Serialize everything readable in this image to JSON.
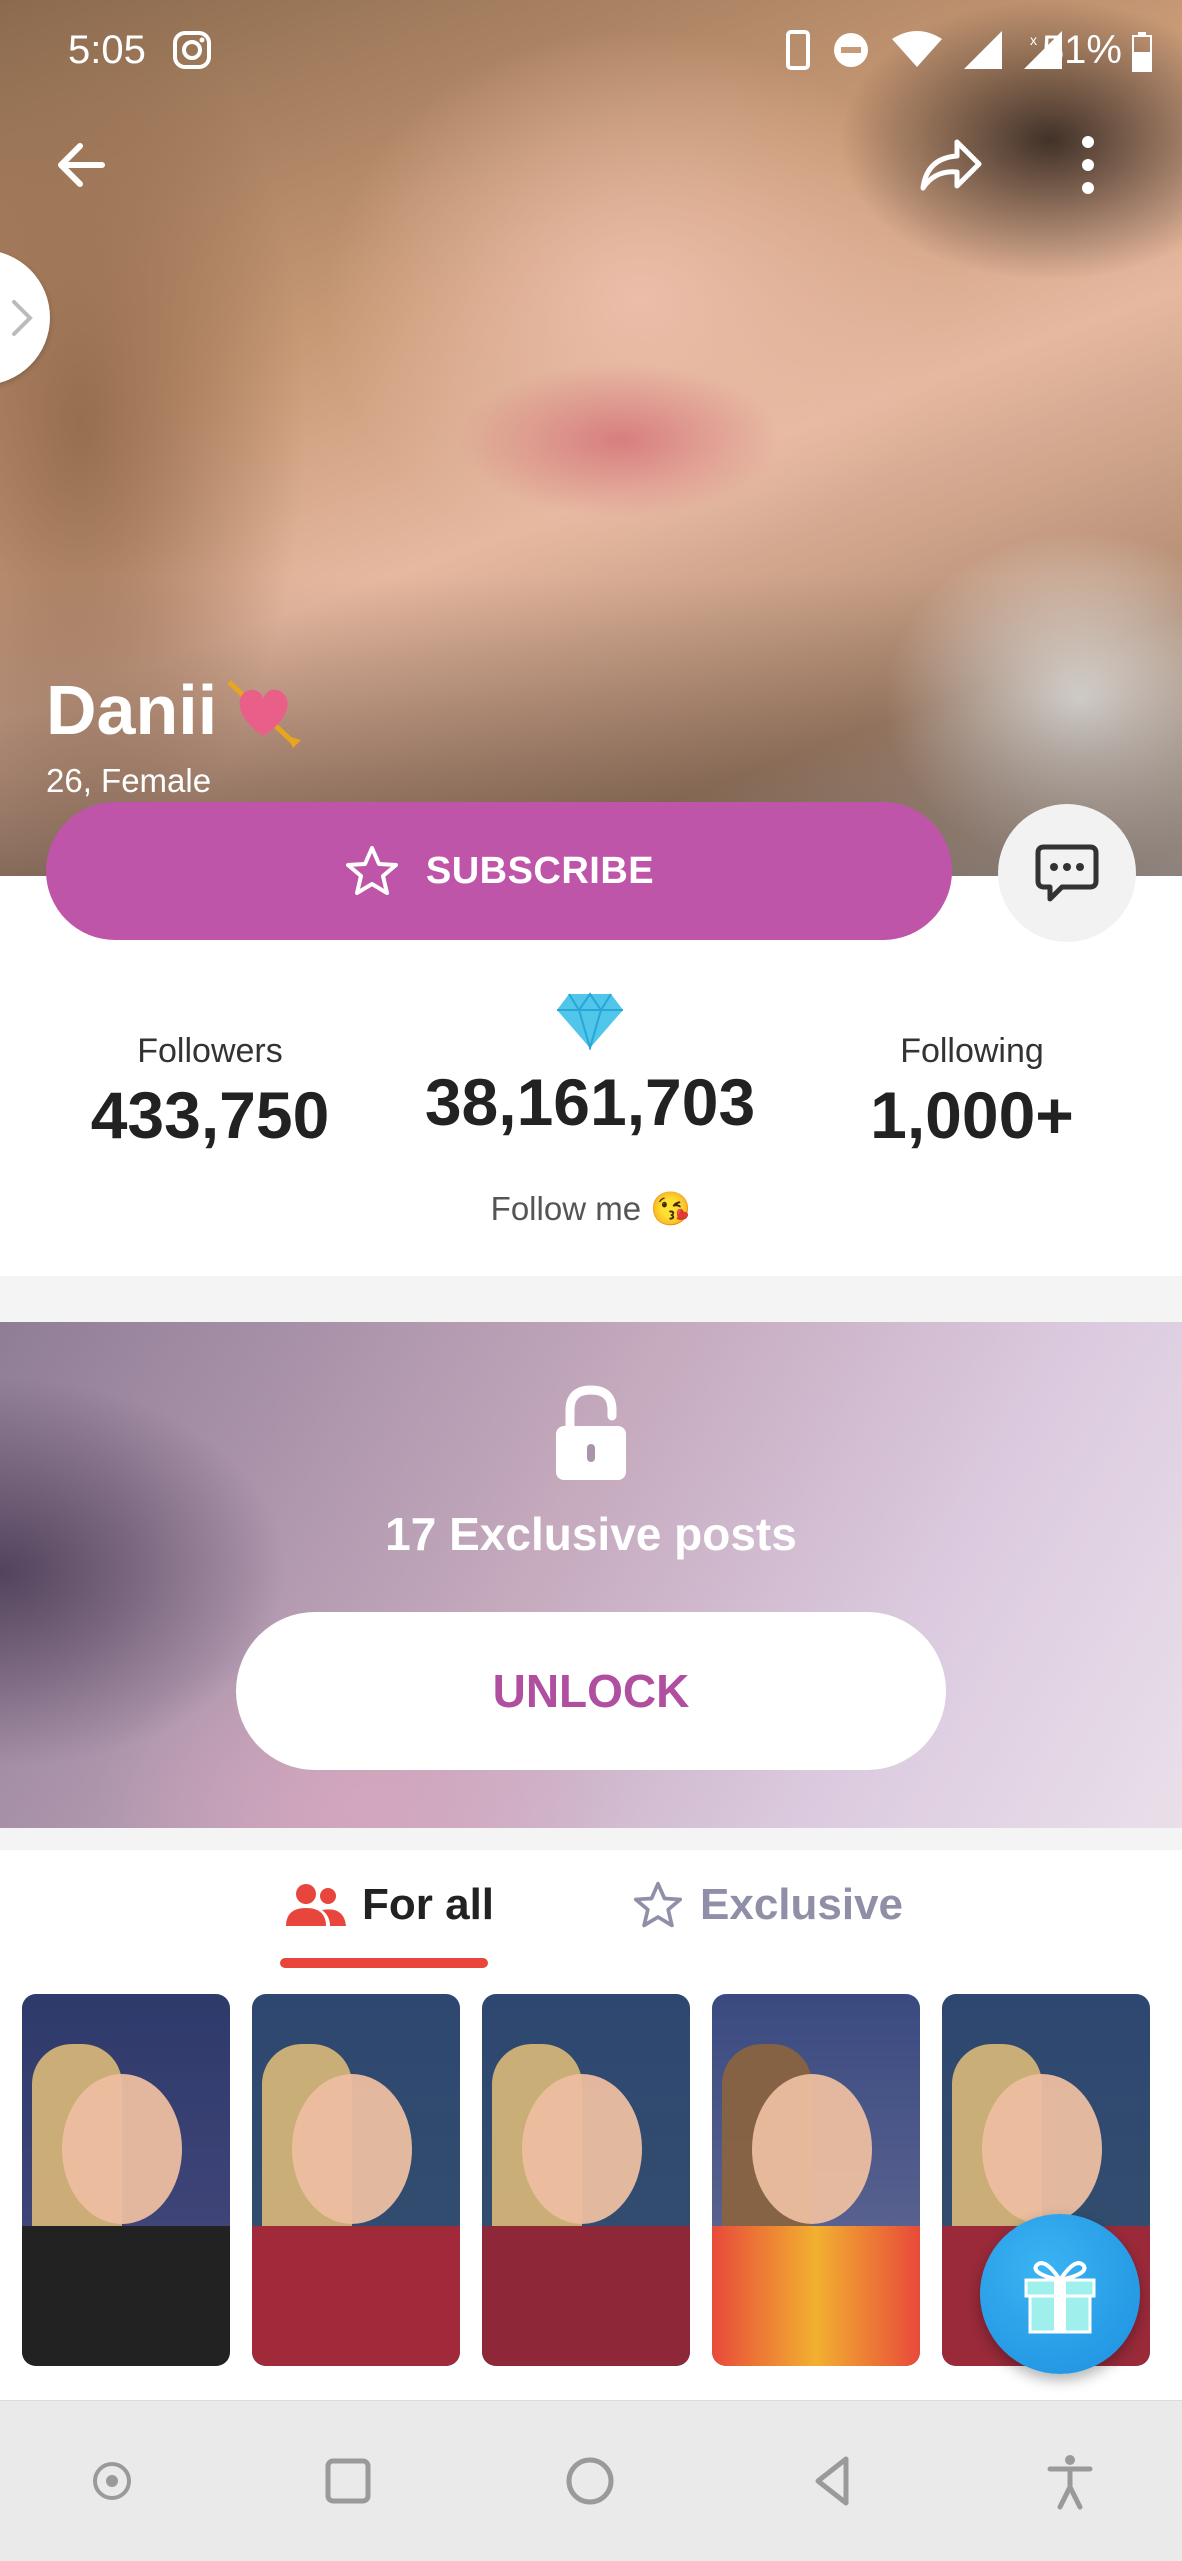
{
  "status_bar": {
    "time": "5:05",
    "battery": "51%",
    "icons": [
      "instagram-icon",
      "phone-icon",
      "dnd-icon",
      "wifi-icon",
      "signal-icon",
      "signal-x-icon",
      "battery-icon"
    ]
  },
  "header": {
    "icons": [
      "back-arrow-icon",
      "share-icon",
      "more-vert-icon",
      "chevron-right-icon"
    ]
  },
  "profile": {
    "name": "Danii",
    "name_icon": "heart-arrow-icon",
    "subtitle": "26, Female",
    "subscribe_label": "SUBSCRIBE",
    "bio": "Follow me 😘"
  },
  "stats": {
    "followers_label": "Followers",
    "followers_value": "433,750",
    "diamonds_value": "38,161,703",
    "following_label": "Following",
    "following_value": "1,000+"
  },
  "exclusive": {
    "text": "17 Exclusive posts",
    "unlock_label": "UNLOCK"
  },
  "tabs": [
    {
      "label": "For all",
      "icon": "people-icon",
      "active": true
    },
    {
      "label": "Exclusive",
      "icon": "star-outline-icon",
      "active": false
    }
  ],
  "colors": {
    "accent": "#bf55a8",
    "tab_underline": "#e8463c",
    "gift": "#1d8fe0"
  }
}
